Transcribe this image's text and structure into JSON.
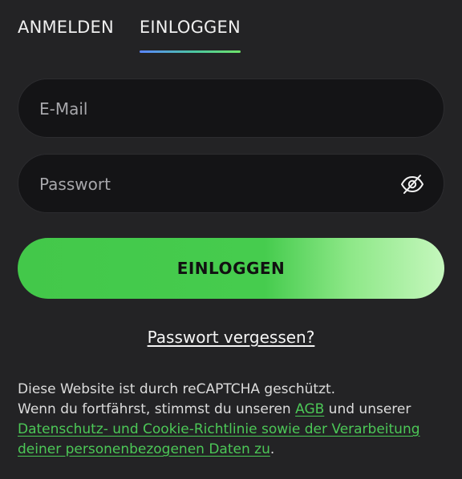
{
  "tabs": {
    "register": "ANMELDEN",
    "login": "EINLOGGEN"
  },
  "form": {
    "email_placeholder": "E-Mail",
    "password_placeholder": "Passwort",
    "email_value": "",
    "password_value": "",
    "submit_label": "EINLOGGEN",
    "visibility_icon": "eye-slash-icon"
  },
  "forgot_link": "Passwort vergessen?",
  "legal": {
    "line1": "Diese Website ist durch reCAPTCHA geschützt.",
    "line2_prefix": "Wenn du fortfährst, stimmst du unseren ",
    "agb_link": "AGB",
    "line2_middle": " und unserer",
    "privacy_link": "Datenschutz- und Cookie-Richtlinie sowie der Verarbeitung deiner personenbezogenen Daten zu",
    "suffix": "."
  },
  "colors": {
    "background": "#232325",
    "field_bg": "#141416",
    "accent_green": "#43c84a",
    "link_green": "#4cc857",
    "tab_underline_start": "#5a86ff",
    "tab_underline_end": "#6ee36a"
  }
}
